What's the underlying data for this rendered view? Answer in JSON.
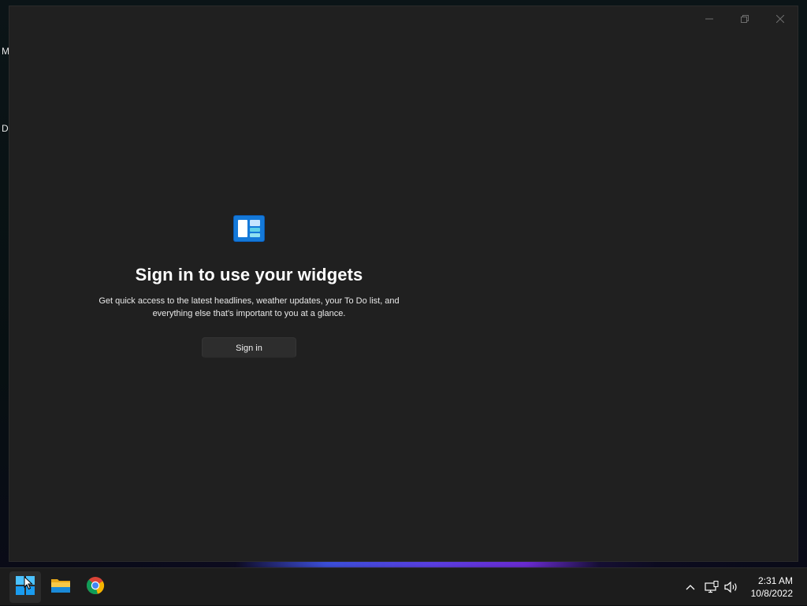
{
  "desktop": {
    "labels": [
      "M",
      "D"
    ]
  },
  "widgets_window": {
    "controls": {
      "minimize_icon": "minimize-icon",
      "restore_icon": "restore-icon",
      "close_icon": "close-icon"
    },
    "logo_icon": "widgets-logo-icon",
    "title": "Sign in to use your widgets",
    "description_line1": "Get quick access to the latest headlines, weather updates, your To Do list, and",
    "description_line2": "everything else that's important to you at a glance.",
    "sign_in_label": "Sign in"
  },
  "taskbar": {
    "apps": [
      "start-icon",
      "file-explorer-icon",
      "chrome-icon"
    ],
    "tray": {
      "icons": [
        "chevron-up-icon",
        "network-icon",
        "volume-icon"
      ],
      "time": "2:31 AM",
      "date": "10/8/2022"
    }
  },
  "colors": {
    "window_bg": "#202020",
    "taskbar_bg": "#1c1c1c",
    "accent": "#0078d4"
  }
}
